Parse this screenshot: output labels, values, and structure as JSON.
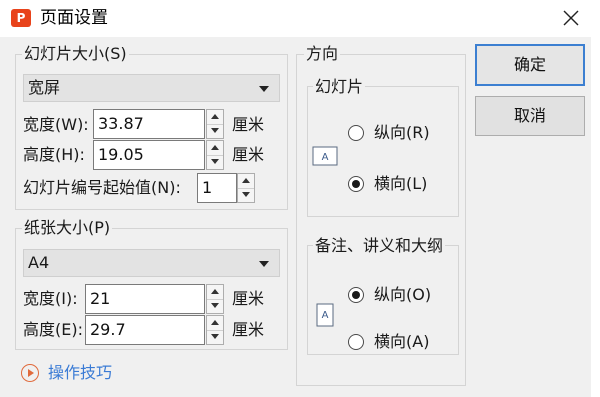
{
  "window": {
    "title": "页面设置",
    "app_icon_letter": "P"
  },
  "slide_size": {
    "legend": "幻灯片大小(S)",
    "select_value": "宽屏",
    "width_label": "宽度(W):",
    "width_value": "33.87",
    "height_label": "高度(H):",
    "height_value": "19.05",
    "unit": "厘米",
    "start_number_label": "幻灯片编号起始值(N):",
    "start_number_value": "1"
  },
  "paper_size": {
    "legend": "纸张大小(P)",
    "select_value": "A4",
    "width_label": "宽度(I):",
    "width_value": "21",
    "height_label": "高度(E):",
    "height_value": "29.7",
    "unit": "厘米"
  },
  "orientation": {
    "legend": "方向",
    "slides": {
      "legend": "幻灯片",
      "portrait_label": "纵向(R)",
      "landscape_label": "横向(L)",
      "selected": "landscape"
    },
    "notes": {
      "legend": "备注、讲义和大纲",
      "portrait_label": "纵向(O)",
      "landscape_label": "横向(A)",
      "selected": "portrait"
    },
    "page_icon_letter": "A"
  },
  "buttons": {
    "ok": "确定",
    "cancel": "取消"
  },
  "tips": {
    "label": "操作技巧"
  },
  "colors": {
    "accent": "#3c7fd1",
    "app_icon": "#e8431b",
    "link": "#3a7bd5"
  }
}
